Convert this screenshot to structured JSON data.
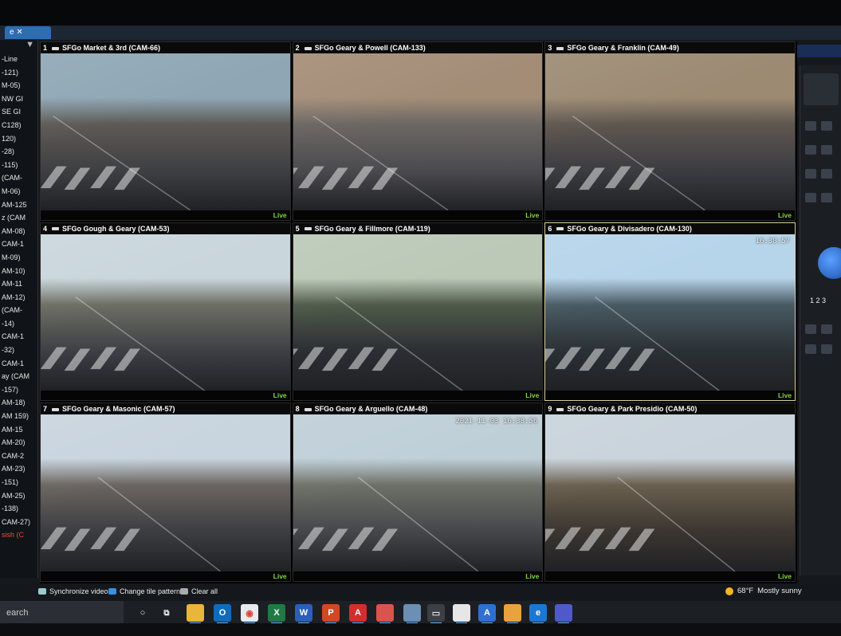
{
  "left_panel": {
    "items": [
      "-Line",
      "-121)",
      "M-05)",
      "NW GI",
      "SE GI",
      "C128)",
      "120)",
      "-28)",
      "-115)",
      "(CAM-",
      "M-06)",
      "AM-125",
      "z (CAM",
      "AM-08)",
      "CAM-1",
      "M-09)",
      "AM-10)",
      "AM-11",
      "AM-12)",
      "(CAM-",
      "-14)",
      "CAM-1",
      "-32)",
      "CAM-1",
      "ay (CAM",
      "-157)",
      "AM-18)",
      "AM 159)",
      "AM-15",
      "AM-20)",
      "CAM-2",
      "AM-23)",
      "-151)",
      "AM-25)",
      "-138)",
      "CAM-27)",
      "sish (C"
    ]
  },
  "tiles": [
    {
      "num": "1",
      "title": "SFGo Market & 3rd (CAM-66)",
      "live": "Live",
      "stamp": "",
      "colors": [
        "#8fa7b5",
        "#5e5a55",
        "#3e3f42"
      ],
      "selected": false
    },
    {
      "num": "2",
      "title": "SFGo Geary & Powell (CAM-133)",
      "live": "Live",
      "stamp": "",
      "colors": [
        "#a48d77",
        "#6c6763",
        "#4a4a4e"
      ],
      "selected": false
    },
    {
      "num": "3",
      "title": "SFGo Geary & Franklin (CAM-49)",
      "live": "Live",
      "stamp": "",
      "colors": [
        "#9c8a73",
        "#5f5750",
        "#3b3c41"
      ],
      "selected": false
    },
    {
      "num": "4",
      "title": "SFGo Gough & Geary (CAM-53)",
      "live": "Live",
      "stamp": "",
      "colors": [
        "#c9d6dc",
        "#6d6e63",
        "#3d3f45"
      ],
      "selected": false
    },
    {
      "num": "5",
      "title": "SFGo Geary & Fillmore (CAM-119)",
      "live": "Live",
      "stamp": "",
      "colors": [
        "#bcc9b7",
        "#4f5a4a",
        "#2c2e33"
      ],
      "selected": false
    },
    {
      "num": "6",
      "title": "SFGo Geary & Divisadero (CAM-130)",
      "live": "Live",
      "stamp": "16:38:57",
      "colors": [
        "#b6d4ea",
        "#495a63",
        "#2a3035"
      ],
      "selected": true
    },
    {
      "num": "7",
      "title": "SFGo Geary & Masonic (CAM-57)",
      "live": "Live",
      "stamp": "",
      "colors": [
        "#c8d4de",
        "#6a6560",
        "#3c3d41"
      ],
      "selected": false
    },
    {
      "num": "8",
      "title": "SFGo Geary & Arguello (CAM-48)",
      "live": "Live",
      "stamp": "2021-11-03 16:38:56",
      "colors": [
        "#bfcfd8",
        "#6e7068",
        "#45464a"
      ],
      "selected": false
    },
    {
      "num": "9",
      "title": "SFGo Geary & Park Presidio (CAM-50)",
      "live": "Live",
      "stamp": "",
      "colors": [
        "#c9d3db",
        "#6a5f4f",
        "#3a3530"
      ],
      "selected": false
    }
  ],
  "toolbar": {
    "sync_label": "Synchronize video",
    "change_tile_label": "Change tile pattern",
    "clear_all_label": "Clear all"
  },
  "taskbar": {
    "search_label": "earch",
    "weather_temp": "68°F",
    "weather_desc": "Mostly sunny"
  },
  "right_panel": {
    "preset_numbers": "1 2 3"
  }
}
